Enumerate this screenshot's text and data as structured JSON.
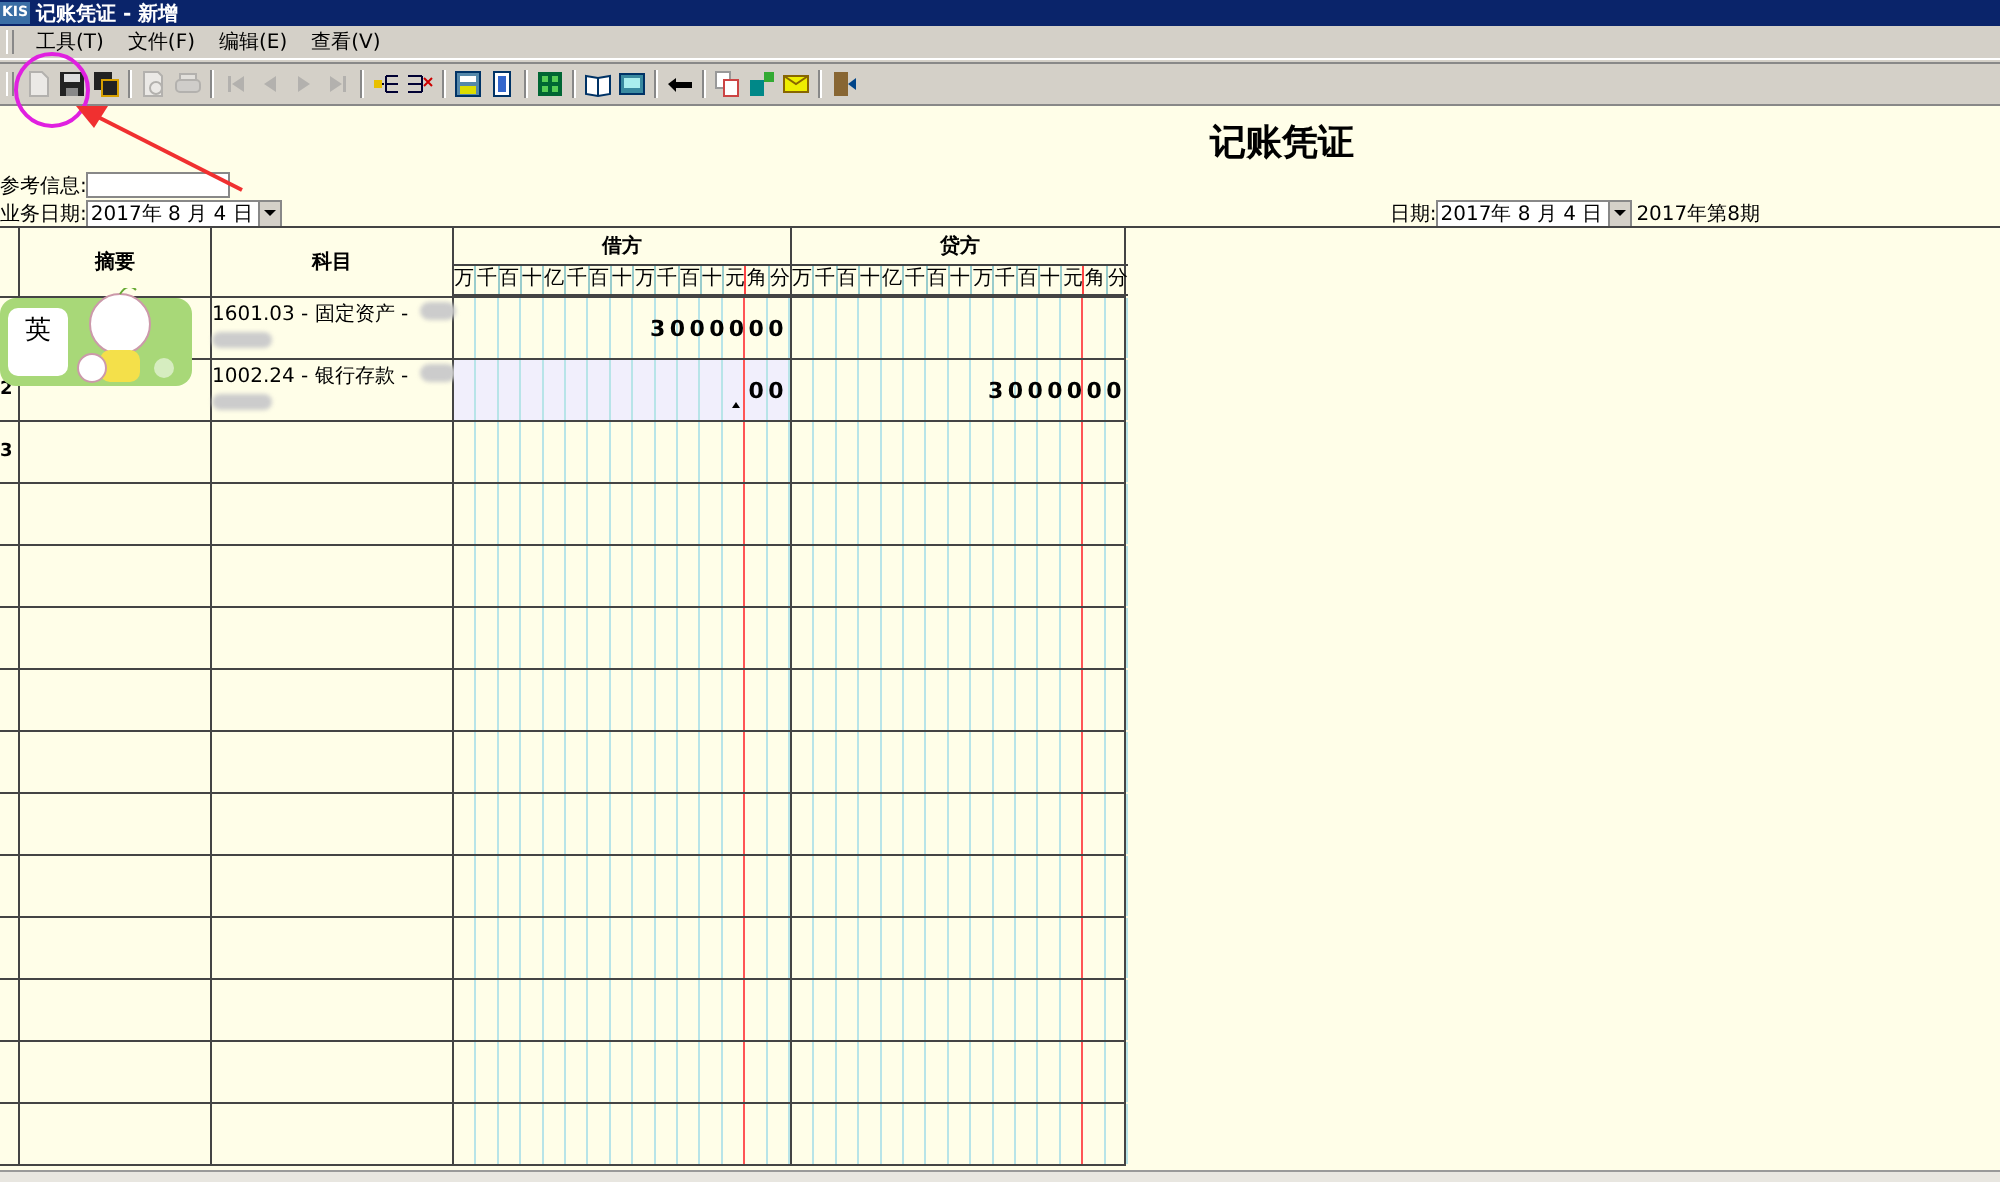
{
  "window": {
    "logo": "KIS",
    "title": "记账凭证 - 新增"
  },
  "menu": [
    {
      "label": "工具(T)"
    },
    {
      "label": "文件(F)"
    },
    {
      "label": "编辑(E)"
    },
    {
      "label": "查看(V)"
    }
  ],
  "toolbar": [
    {
      "kind": "new",
      "disabled": true
    },
    {
      "kind": "save",
      "disabled": false
    },
    {
      "kind": "saveall",
      "disabled": false
    },
    {
      "kind": "sep"
    },
    {
      "kind": "preview",
      "disabled": true
    },
    {
      "kind": "print",
      "disabled": true
    },
    {
      "kind": "sep"
    },
    {
      "kind": "first",
      "disabled": true
    },
    {
      "kind": "prev",
      "disabled": true
    },
    {
      "kind": "next",
      "disabled": true
    },
    {
      "kind": "last",
      "disabled": true
    },
    {
      "kind": "sep"
    },
    {
      "kind": "insert",
      "disabled": false
    },
    {
      "kind": "delete",
      "disabled": false
    },
    {
      "kind": "sep"
    },
    {
      "kind": "calc",
      "disabled": false
    },
    {
      "kind": "book",
      "disabled": false
    },
    {
      "kind": "sep"
    },
    {
      "kind": "grid",
      "disabled": false
    },
    {
      "kind": "sep"
    },
    {
      "kind": "openbook",
      "disabled": false
    },
    {
      "kind": "monitor",
      "disabled": false
    },
    {
      "kind": "sep"
    },
    {
      "kind": "back",
      "disabled": false
    },
    {
      "kind": "sep"
    },
    {
      "kind": "copy",
      "disabled": false
    },
    {
      "kind": "transfer",
      "disabled": false
    },
    {
      "kind": "mail",
      "disabled": false
    },
    {
      "kind": "sep"
    },
    {
      "kind": "exit",
      "disabled": false
    }
  ],
  "voucher": {
    "title": "记账凭证",
    "reference": {
      "label": "参考信息:"
    },
    "business_date": {
      "label": "业务日期:",
      "value": "2017年 8 月 4 日"
    },
    "date": {
      "label": "日期:",
      "value": "2017年 8 月 4 日",
      "period": "2017年第8期"
    }
  },
  "table": {
    "columns": {
      "summary": "摘要",
      "account": "科目",
      "debit": "借方",
      "credit": "贷方"
    },
    "debit_units": [
      "万",
      "千",
      "百",
      "十",
      "亿",
      "千",
      "百",
      "十",
      "万",
      "千",
      "百",
      "十",
      "元",
      "角",
      "分"
    ],
    "credit_units": [
      "万",
      "千",
      "百",
      "十",
      "亿",
      "千",
      "百",
      "十",
      "万",
      "千",
      "百",
      "十",
      "元",
      "角",
      "分"
    ],
    "rows": [
      {
        "account": "1601.03 - 固定资产 -",
        "debit": "3000000",
        "selected": false
      },
      {
        "number": "2",
        "account": "1002.24 - 银行存款 -",
        "debit": "00",
        "credit": "3000000",
        "selected": true
      },
      {
        "number": "3",
        "selected": false
      },
      {
        "selected": false
      },
      {
        "selected": false
      },
      {
        "selected": false
      },
      {
        "selected": false
      },
      {
        "selected": false
      },
      {
        "selected": false
      },
      {
        "selected": false
      },
      {
        "selected": false
      },
      {
        "selected": false
      },
      {
        "selected": false
      },
      {
        "selected": false
      }
    ]
  },
  "ime_status": {
    "label": "英"
  }
}
